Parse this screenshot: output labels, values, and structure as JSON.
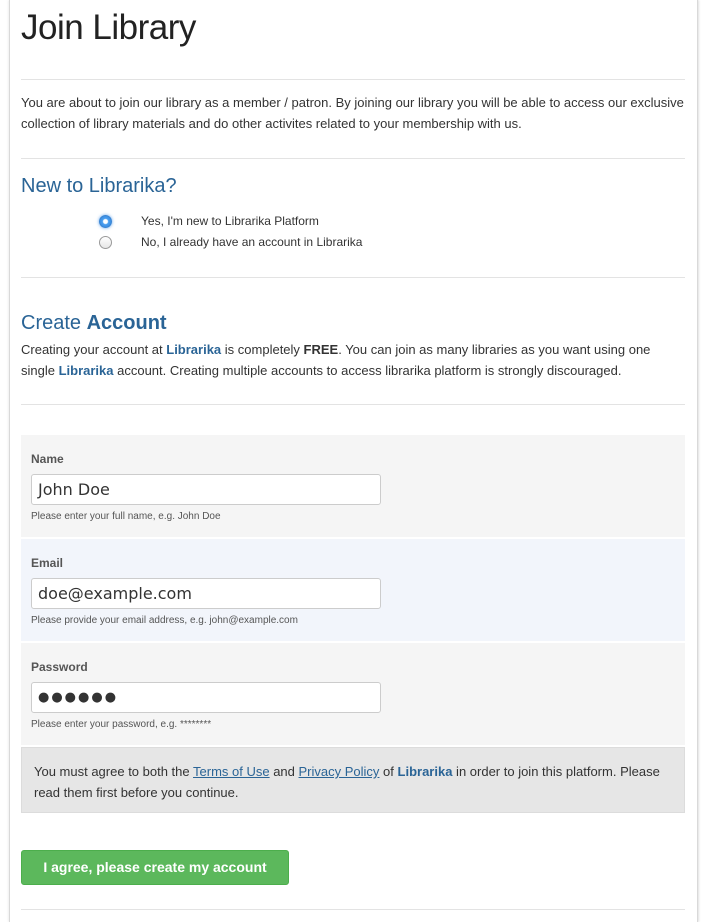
{
  "page": {
    "title": "Join Library",
    "intro": "You are about to join our library as a member / patron. By joining our library you will be able to access our exclusive collection of library materials and do other activites related to your membership with us."
  },
  "new_user": {
    "heading": "New to Librarika?",
    "options": [
      {
        "label": "Yes, I'm new to Librarika Platform",
        "checked": true
      },
      {
        "label": "No, I already have an account in Librarika",
        "checked": false
      }
    ]
  },
  "create_account": {
    "heading_prefix": "Create ",
    "heading_bold": "Account",
    "desc_1": "Creating your account at ",
    "brand": "Librarika",
    "desc_2": " is completely ",
    "free": "FREE",
    "desc_3": ". You can join as many libraries as you want using one single ",
    "desc_4": " account. Creating multiple accounts to access librarika platform is strongly discouraged."
  },
  "form": {
    "name": {
      "label": "Name",
      "value": "John Doe",
      "help": "Please enter your full name, e.g. John Doe"
    },
    "email": {
      "label": "Email",
      "value": "doe@example.com",
      "help": "Please provide your email address, e.g. john@example.com"
    },
    "password": {
      "label": "Password",
      "value": "●●●●●●",
      "help": "Please enter your password, e.g. ********"
    }
  },
  "agreement": {
    "text_1": "You must agree to both the ",
    "terms_link": "Terms of Use",
    "text_2": " and ",
    "privacy_link": "Privacy Policy",
    "text_3": " of ",
    "brand": "Librarika",
    "text_4": " in order to join this platform. Please read them first before you continue."
  },
  "submit": {
    "label": "I agree, please create my account"
  },
  "colors": {
    "heading": "#2a6496",
    "button": "#5cb85c",
    "radio_accent": "#3b86d4"
  }
}
